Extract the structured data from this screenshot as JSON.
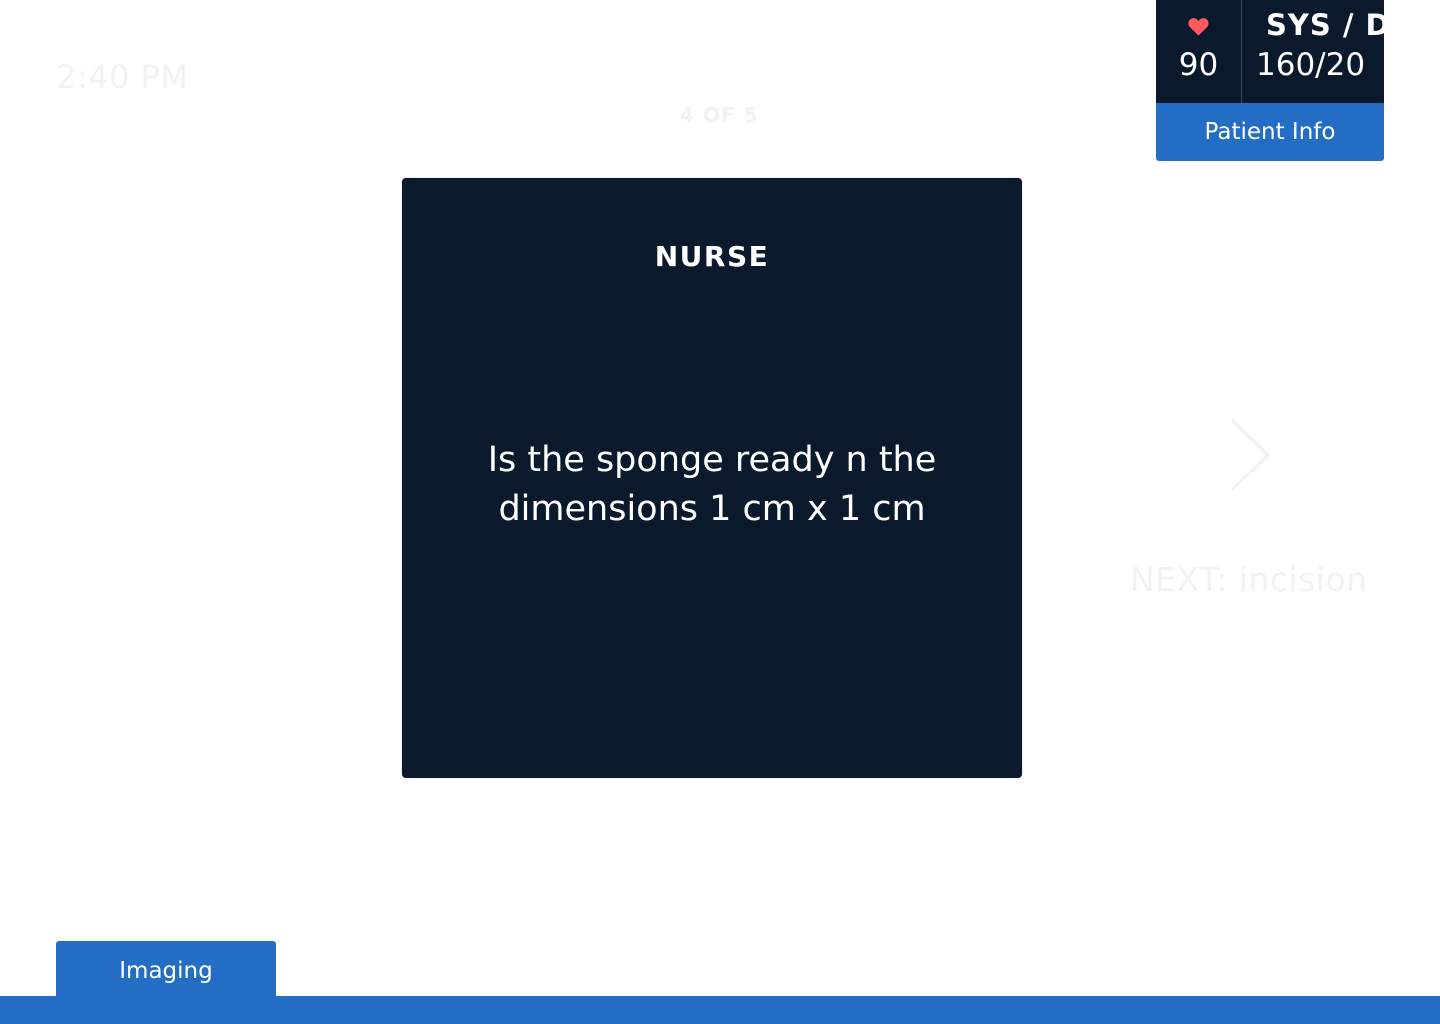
{
  "header": {
    "time": "2:40 PM",
    "step_counter": "4 OF 5"
  },
  "card": {
    "role": "NURSE",
    "prompt": "Is the sponge ready n the dimensions 1 cm x 1 cm"
  },
  "navigation": {
    "next_label": "NEXT: incision",
    "next_icon": "chevron-right-icon"
  },
  "vitals": {
    "heart_icon": "heart-icon",
    "heart_rate": "90",
    "bp_label": "SYS / DIA",
    "bp_value": "160/20",
    "patient_info_label": "Patient Info"
  },
  "footer": {
    "imaging_tab_label": "Imaging"
  },
  "colors": {
    "card_background": "#0a192b",
    "accent_blue": "#236dc4",
    "heart": "#ff5a5f",
    "faded_text": "#f1f2f4"
  }
}
